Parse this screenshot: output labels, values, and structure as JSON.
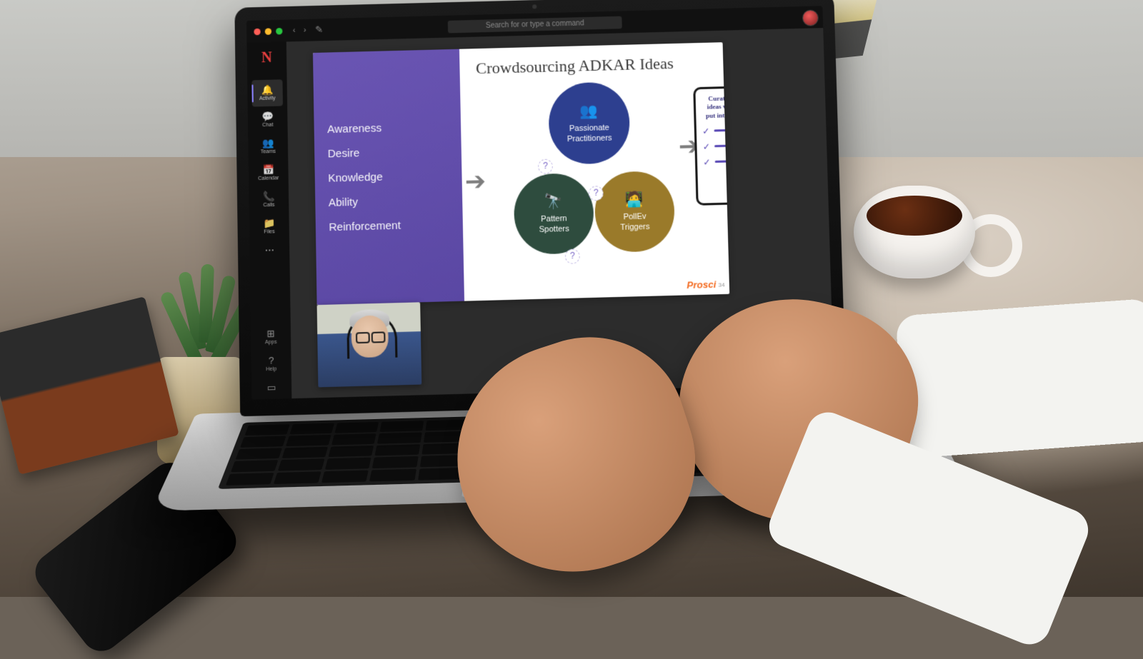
{
  "titlebar": {
    "search_placeholder": "Search for or type a command"
  },
  "rail": {
    "logo_letter": "N",
    "items": [
      {
        "icon": "🔔",
        "label": "Activity"
      },
      {
        "icon": "💬",
        "label": "Chat"
      },
      {
        "icon": "👥",
        "label": "Teams"
      },
      {
        "icon": "📅",
        "label": "Calendar"
      },
      {
        "icon": "📞",
        "label": "Calls"
      },
      {
        "icon": "📁",
        "label": "Files"
      },
      {
        "icon": "⋯",
        "label": ""
      }
    ],
    "bottom": [
      {
        "icon": "⊞",
        "label": "Apps"
      },
      {
        "icon": "?",
        "label": "Help"
      },
      {
        "icon": "▭",
        "label": ""
      }
    ]
  },
  "slide": {
    "title": "Crowdsourcing ADKAR Ideas",
    "adkar": [
      "Awareness",
      "Desire",
      "Knowledge",
      "Ability",
      "Reinforcement"
    ],
    "circles": {
      "blue": {
        "line1": "Passionate",
        "line2": "Practitioners"
      },
      "green": {
        "line1": "Pattern",
        "line2": "Spotters"
      },
      "gold": {
        "line1": "PollEv",
        "line2": "Triggers"
      }
    },
    "dot_label": "?",
    "card_caption": "Curated list of ideas we can all put into practice",
    "brand": "Prosci",
    "page_number": "34"
  }
}
